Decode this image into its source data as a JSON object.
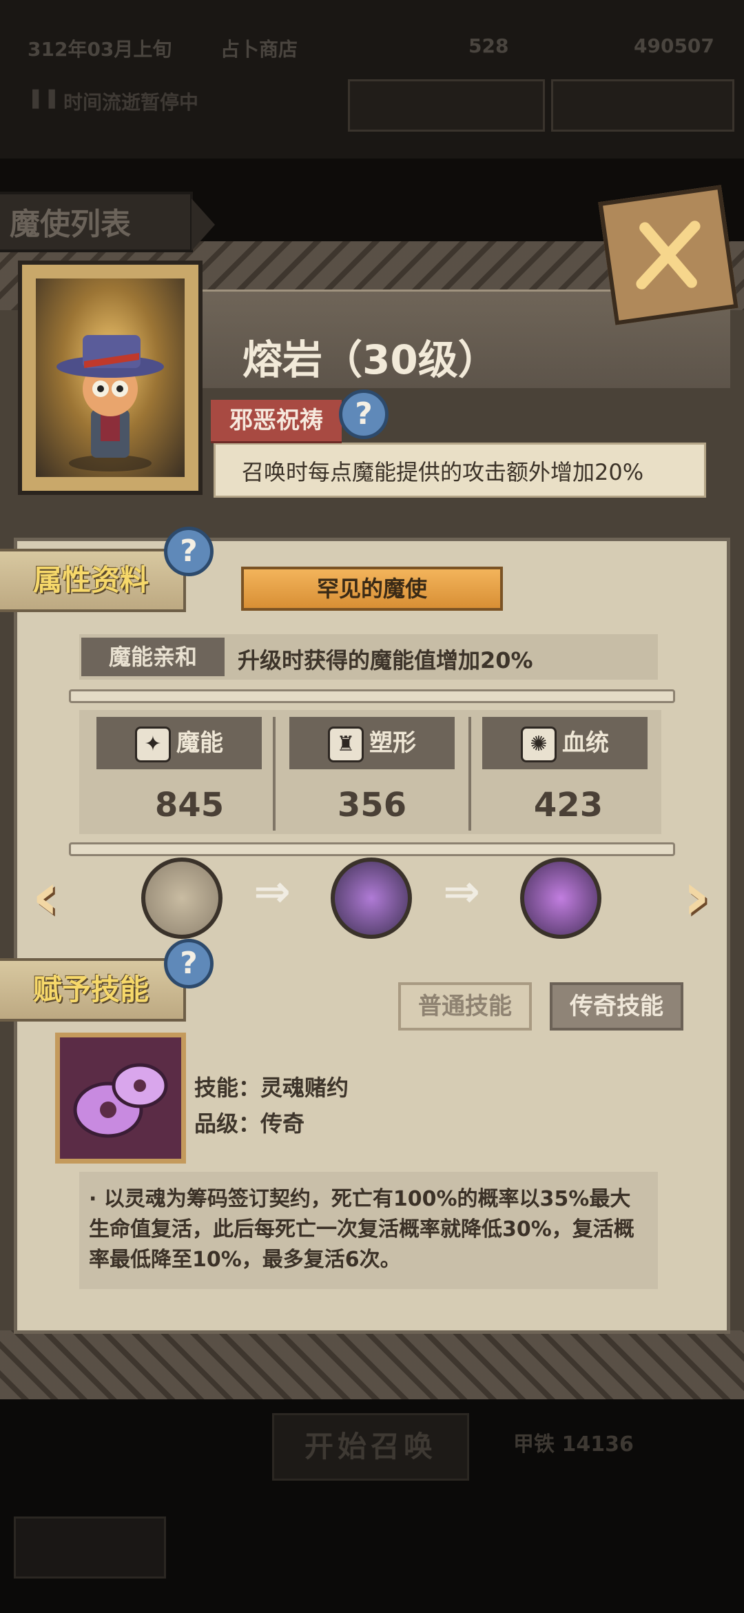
{
  "background": {
    "date": "312年03月上旬",
    "shop": "占卜商店",
    "currency1": "528",
    "currency2": "490507",
    "time_status": "时间流逝暂停中",
    "start_summon": "开始召唤",
    "summon_cost": "甲铁 14136"
  },
  "list_tab": "魔使列表",
  "hero": {
    "name": "熔岩（30级）",
    "trait_name": "邪恶祝祷",
    "trait_desc": "召唤时每点魔能提供的攻击额外增加20%"
  },
  "attributes": {
    "section_label": "属性资料",
    "rarity": "罕见的魔使",
    "affinity_label": "魔能亲和",
    "affinity_text": "升级时获得的魔能值增加20%",
    "stats": [
      {
        "name": "魔能",
        "value": "845",
        "icon": "magic-icon"
      },
      {
        "name": "塑形",
        "value": "356",
        "icon": "body-icon"
      },
      {
        "name": "血统",
        "value": "423",
        "icon": "bloodline-icon"
      }
    ]
  },
  "skills": {
    "section_label": "赋予技能",
    "normal_tab": "普通技能",
    "legend_tab": "传奇技能",
    "skill_name_line": "技能：灵魂赌约",
    "skill_grade_line": "品级：传奇",
    "description": "·   以灵魂为筹码签订契约，死亡有100%的概率以35%最大生命值复活，此后每死亡一次复活概率就降低30%，复活概率最低降至10%，最多复活6次。"
  }
}
